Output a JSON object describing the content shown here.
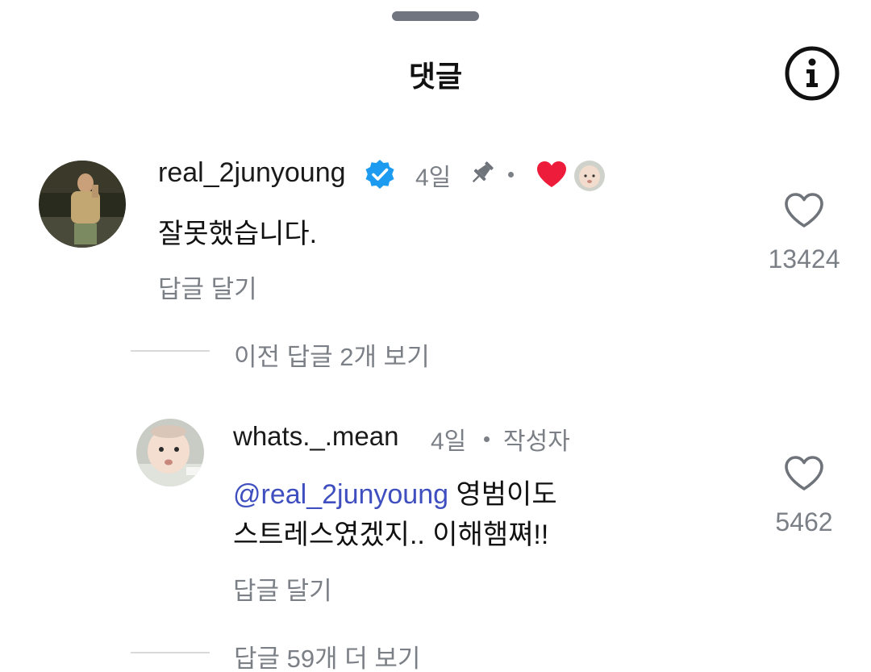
{
  "header": {
    "title": "댓글",
    "info_icon": "info-circle-icon"
  },
  "comments": [
    {
      "username": "real_2junyoung",
      "verified": true,
      "time": "4일",
      "pinned": true,
      "liked_by_author": true,
      "text": "잘못했습니다.",
      "reply_label": "답글 달기",
      "like_count": "13424",
      "view_replies_label": "이전 답글 2개 보기"
    },
    {
      "username": "whats._.mean",
      "time": "4일",
      "author_badge": "작성자",
      "mention": "@real_2junyoung",
      "text_line1": " 영범이도",
      "text_line2": "스트레스였겠지.. 이해햄쪄!!",
      "reply_label": "답글 달기",
      "like_count": "5462",
      "more_replies_label": "답글 59개 더 보기"
    }
  ],
  "colors": {
    "verified": "#1d9bf0",
    "heart_filled": "#ed1c3a",
    "mention": "#3f4fbf",
    "muted_text": "#7b7f86"
  }
}
